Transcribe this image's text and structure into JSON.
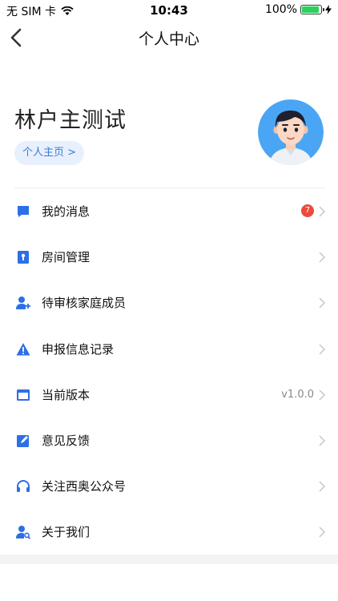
{
  "status_bar": {
    "carrier": "无 SIM 卡",
    "time": "10:43",
    "battery_percent": "100%",
    "battery_level": 1.0
  },
  "nav": {
    "title": "个人中心"
  },
  "profile": {
    "name": "林户主测试",
    "home_link": "个人主页 >"
  },
  "menu": [
    {
      "label": "我的消息",
      "icon": "message-icon",
      "badge": "7"
    },
    {
      "label": "房间管理",
      "icon": "lock-icon"
    },
    {
      "label": "待审核家庭成员",
      "icon": "add-user-icon"
    },
    {
      "label": "申报信息记录",
      "icon": "warning-icon"
    },
    {
      "label": "当前版本",
      "icon": "window-icon",
      "value": "v1.0.0"
    },
    {
      "label": "意见反馈",
      "icon": "edit-icon"
    },
    {
      "label": "关注西奥公众号",
      "icon": "headset-icon"
    },
    {
      "label": "关于我们",
      "icon": "user-search-icon"
    }
  ],
  "colors": {
    "accent": "#2d6fe6",
    "badge": "#ea4c3c",
    "home_button_bg": "#e8f0fd",
    "avatar_bg": "#4aa6f5"
  }
}
